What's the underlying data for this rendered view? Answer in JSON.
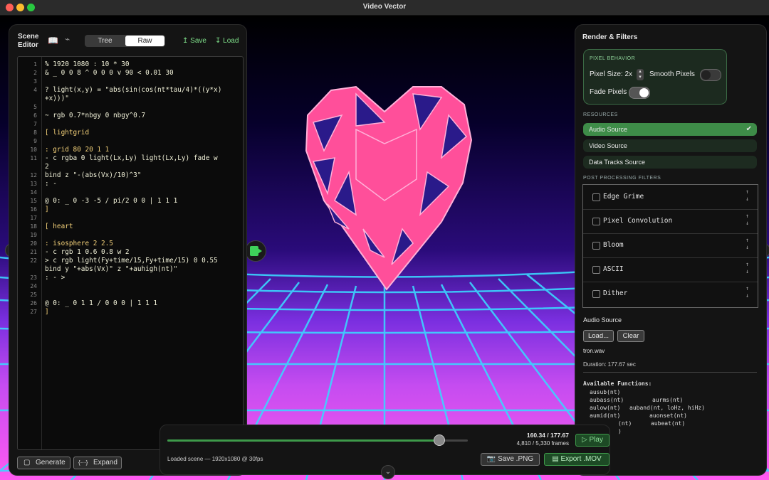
{
  "window": {
    "title": "Video Vector"
  },
  "editor": {
    "title": "Scene Editor",
    "tabs": [
      "Tree",
      "Raw"
    ],
    "active_tab": "Raw",
    "save_label": "Save",
    "load_label": "Load",
    "lines": [
      {
        "n": "1",
        "text": "% 1920 1080 : 10 * 30",
        "color": "#f1f1d8"
      },
      {
        "n": "2",
        "text": "& _ 0 0 8 ^ 0 0 0 v 90 < 0.01 30",
        "color": "#f1f1d8"
      },
      {
        "n": "3",
        "text": "",
        "color": "#f1f1d8"
      },
      {
        "n": "4",
        "text": "? light(x,y) = \"abs(sin(cos(nt*tau/4)*((y*x)",
        "color": "#f1f1d8"
      },
      {
        "n": "",
        "text": "+x)))\"",
        "color": "#f1f1d8"
      },
      {
        "n": "5",
        "text": "",
        "color": "#f1f1d8"
      },
      {
        "n": "6",
        "text": "~ rgb 0.7*nbgy 0 nbgy^0.7",
        "color": "#f1f1d8"
      },
      {
        "n": "7",
        "text": "",
        "color": "#f1f1d8"
      },
      {
        "n": "8",
        "text": "[ lightgrid",
        "color": "#f5d27a"
      },
      {
        "n": "9",
        "text": "",
        "color": "#f1f1d8"
      },
      {
        "n": "10",
        "text": ": grid 80 20 1 1",
        "color": "#f5d27a"
      },
      {
        "n": "11",
        "text": "- c rgba 0 light(Lx,Ly) light(Lx,Ly) fade w",
        "color": "#f1f1d8"
      },
      {
        "n": "",
        "text": "2",
        "color": "#f1f1d8"
      },
      {
        "n": "12",
        "text": "bind z \"-(abs(Vx)/10)^3\"",
        "color": "#f1f1d8"
      },
      {
        "n": "13",
        "text": ": -",
        "color": "#f1f1d8"
      },
      {
        "n": "14",
        "text": "",
        "color": "#f1f1d8"
      },
      {
        "n": "15",
        "text": "@ 0: _ 0 -3 -5 / pi/2 0 0 | 1 1 1",
        "color": "#f1f1d8"
      },
      {
        "n": "16",
        "text": "]",
        "color": "#f5d27a"
      },
      {
        "n": "17",
        "text": "",
        "color": "#f1f1d8"
      },
      {
        "n": "18",
        "text": "[ heart",
        "color": "#f5d27a"
      },
      {
        "n": "19",
        "text": "",
        "color": "#f1f1d8"
      },
      {
        "n": "20",
        "text": ": isosphere 2 2.5",
        "color": "#f5d27a"
      },
      {
        "n": "21",
        "text": "- c rgb 1 0.6 0.8 w 2",
        "color": "#f1f1d8"
      },
      {
        "n": "22",
        "text": "> c rgb light(Fy+time/15,Fy+time/15) 0 0.55",
        "color": "#f1f1d8"
      },
      {
        "n": "",
        "text": "bind y \"+abs(Vx)\" z \"+auhigh(nt)\"",
        "color": "#f1f1d8"
      },
      {
        "n": "23",
        "text": ": - >",
        "color": "#f1f1d8"
      },
      {
        "n": "24",
        "text": "",
        "color": "#f1f1d8"
      },
      {
        "n": "25",
        "text": "",
        "color": "#f1f1d8"
      },
      {
        "n": "26",
        "text": "@ 0: _ 0 1 1 / 0 0 0 | 1 1 1",
        "color": "#f1f1d8"
      },
      {
        "n": "27",
        "text": "]",
        "color": "#f5d27a"
      }
    ],
    "generate_label": "Generate",
    "expand_label": "Expand"
  },
  "render": {
    "title": "Render & Filters",
    "pixel_behavior": {
      "header": "PIXEL BEHAVIOR",
      "pixel_size_label": "Pixel Size: 2x",
      "smooth_pixels_label": "Smooth Pixels",
      "smooth_pixels_on": false,
      "fade_pixels_label": "Fade Pixels",
      "fade_pixels_on": true
    },
    "resources_header": "RESOURCES",
    "resources": [
      {
        "label": "Audio Source",
        "active": true
      },
      {
        "label": "Video Source",
        "active": false
      },
      {
        "label": "Data Tracks Source",
        "active": false
      }
    ],
    "filters_header": "POST PROCESSING FILTERS",
    "filters": [
      "Edge Grime",
      "Pixel Convolution",
      "Bloom",
      "ASCII",
      "Dither"
    ],
    "audio": {
      "title": "Audio Source",
      "load_label": "Load...",
      "clear_label": "Clear",
      "file": "tron.wav",
      "duration": "Duration: 177.67 sec"
    },
    "functions_title": "Available Functions:",
    "functions": [
      [
        "ausub(nt)",
        ""
      ],
      [
        "aubass(nt)",
        "aurms(nt)"
      ],
      [
        "aulow(nt)",
        "auband(nt, loHz, hiHz)"
      ],
      [
        "aumid(nt)",
        "auonset(nt)"
      ],
      [
        "(nt)",
        "aubeat(nt)"
      ],
      [
        ")",
        ""
      ]
    ]
  },
  "playback": {
    "time": "160.34 / 177.67",
    "frames": "4,810 / 5,330 frames",
    "progress": 0.902,
    "play_label": "Play",
    "status": "Loaded scene — 1920x1080 @ 30fps",
    "save_png_label": "Save .PNG",
    "export_label": "Export .MOV"
  },
  "colors": {
    "accent": "#3e9a4a",
    "heart_pink": "#ff4f9a",
    "heart_navy": "#2a1a8a",
    "grid": "#3bd6ff"
  }
}
